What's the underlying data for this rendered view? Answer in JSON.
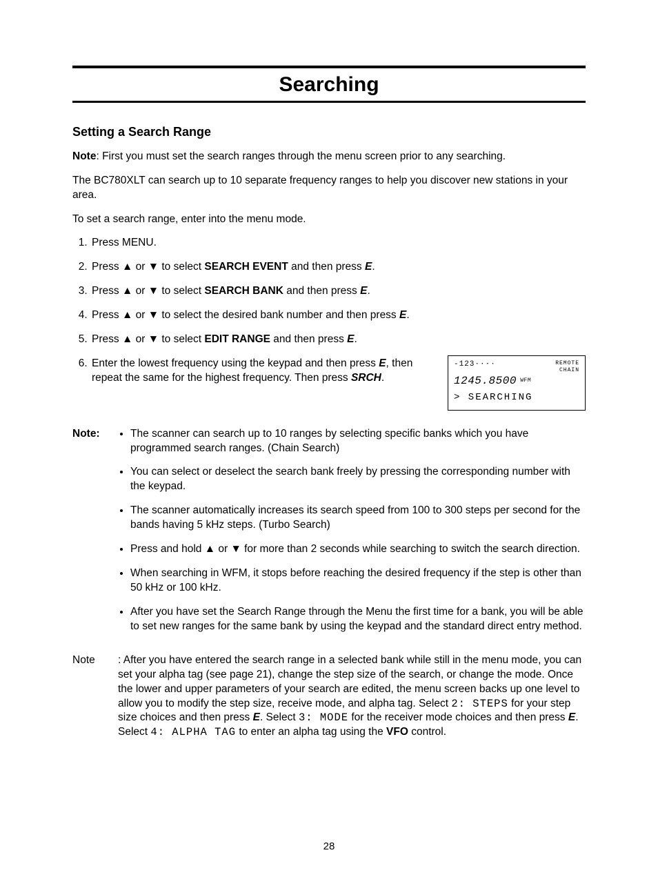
{
  "title": "Searching",
  "subheading": "Setting a Search Range",
  "noteLabel": "Note",
  "intro": {
    "noteText": ":  First you must set the search ranges through the menu screen prior to any searching.",
    "p1": "The BC780XLT can search up to 10 separate frequency ranges to help you discover new stations in your area.",
    "p2": "To set a search range, enter into the menu mode."
  },
  "arrows": {
    "up": "▲",
    "down": "▼"
  },
  "steps": {
    "s1": "Press MENU.",
    "s2a": "Press ",
    "s2b": " or ",
    "s2c": " to select ",
    "s2term": "SEARCH EVENT",
    "s2d": " and then press ",
    "s2key": "E",
    "s2e": ".",
    "s3a": "Press ",
    "s3b": " or ",
    "s3c": " to select ",
    "s3term": "SEARCH BANK",
    "s3d": " and then press ",
    "s3key": "E",
    "s3e": ".",
    "s4a": "Press ",
    "s4b": " or ",
    "s4c": " to select the desired bank number and then press ",
    "s4key": "E",
    "s4d": ".",
    "s5a": "Press ",
    "s5b": " or ",
    "s5c": " to select ",
    "s5term": "EDIT RANGE",
    "s5d": " and then press ",
    "s5key": "E",
    "s5e": ".",
    "s6a": "Enter the lowest frequency using the keypad and then press ",
    "s6key1": "E",
    "s6b": ", then repeat the same for the highest frequency. Then press ",
    "s6key2": "SRCH",
    "s6c": "."
  },
  "lcd": {
    "row1a": "-123····",
    "row1b": "REMOTE\nCHAIN",
    "row2a": "1245.8500",
    "row2b": " WFM",
    "row3": "> SEARCHING"
  },
  "noteBullets": [
    "The scanner can search up to 10 ranges by selecting specific banks which you have programmed search ranges. (Chain Search)",
    "You can select or deselect the search bank freely by pressing the corresponding number with the keypad.",
    "The scanner automatically increases its search speed from 100 to 300 steps per second for the bands having 5 kHz steps. (Turbo Search)"
  ],
  "bullet4": {
    "a": "Press and hold ",
    "b": " or ",
    "c": " for more than 2 seconds while searching to switch the search direction."
  },
  "bullet5": "When searching in WFM, it stops before reaching the desired frequency if the step is other than 50 kHz or 100 kHz.",
  "bullet6": "After you have set the Search Range through the Menu the first time for a bank, you will be able to set new ranges for the same bank by using the keypad and the standard direct entry method.",
  "note2": {
    "a": ":  After you have entered the search range in a selected bank while still in the menu mode, you can set your alpha tag (see page 21), change the step size of the search, or change the mode. Once the lower and upper parameters of your search are edited, the menu screen backs up one level to allow you to modify the step size, receive mode, and alpha tag. Select ",
    "m1": "2: STEPS",
    "b": " for your step size choices and then press ",
    "k1": "E",
    "c": ". Select ",
    "m2": "3: MODE",
    "d": " for the receiver mode choices and then press ",
    "k2": "E",
    "e": ". Select ",
    "m3": "4: ALPHA TAG",
    "f": " to enter an alpha tag using the ",
    "vfo": "VFO",
    "g": " control."
  },
  "pageNumber": "28"
}
